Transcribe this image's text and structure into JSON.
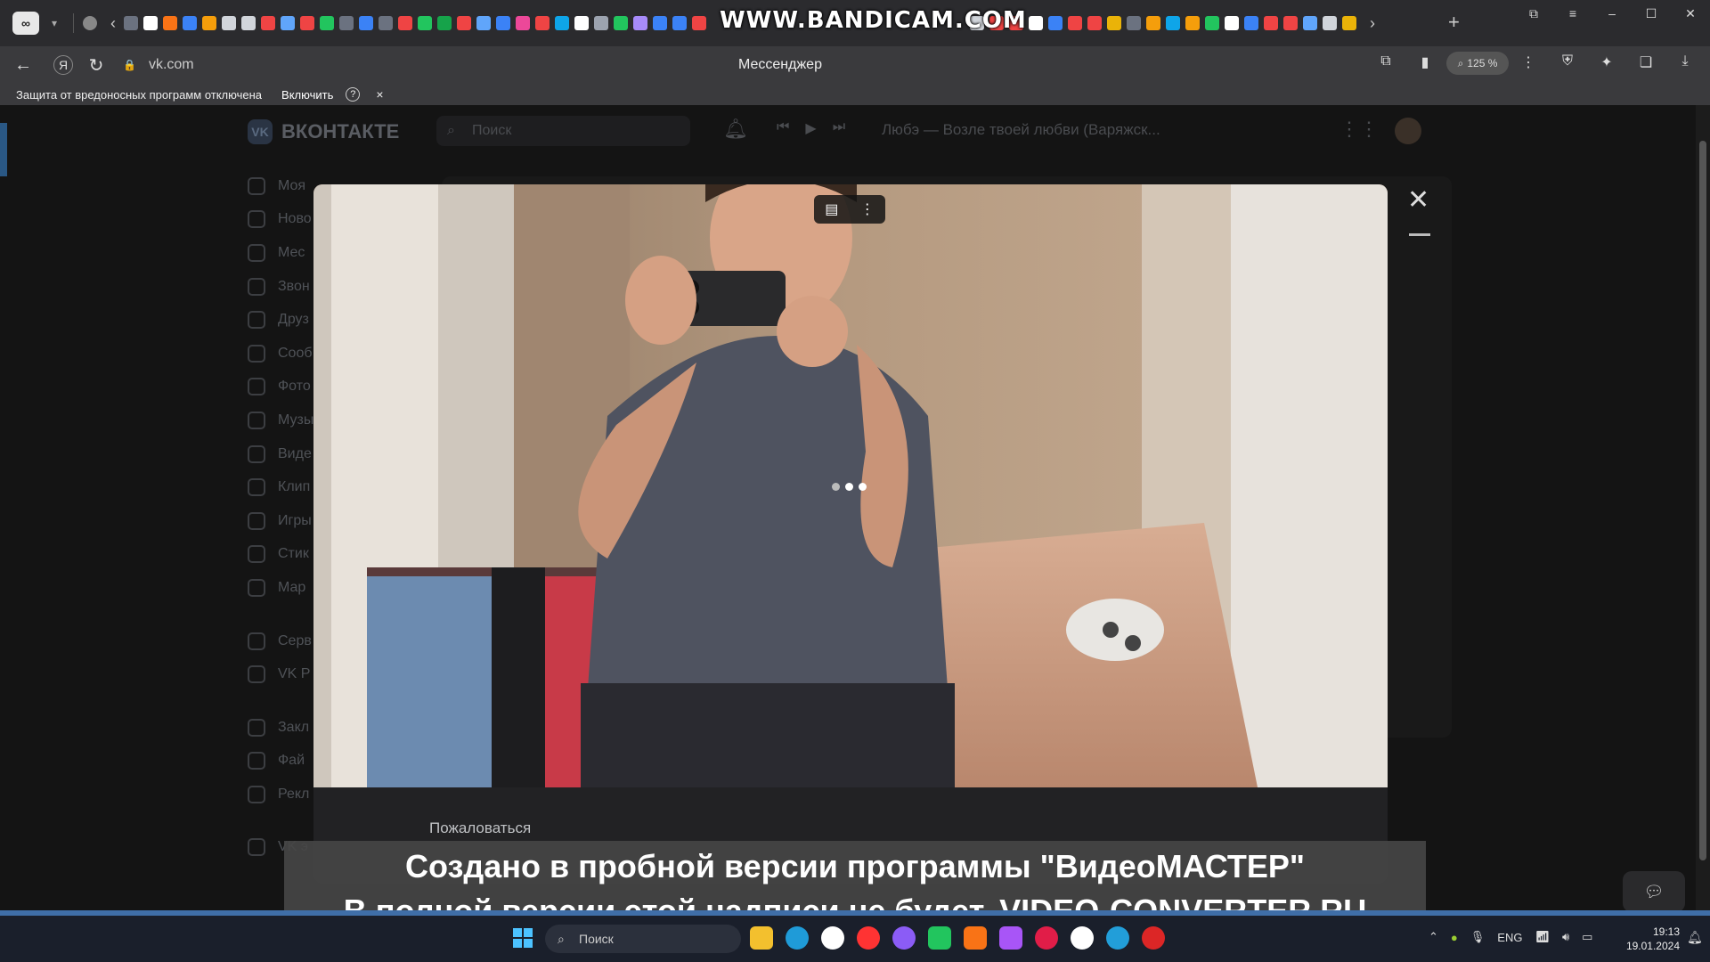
{
  "browser": {
    "watermark": "WWW.BANDICAM.COM",
    "page_title": "Мессенджер",
    "url": "vk.com",
    "zoom": "125 %",
    "infobar": {
      "message": "Защита от вредоносных программ отключена",
      "enable_label": "Включить",
      "help": "?",
      "close": "×"
    },
    "controls": {
      "back": "←",
      "reload": "↻",
      "yandex": "Я",
      "minimize": "–",
      "maximize": "☐",
      "close": "✕",
      "new_tab": "+"
    }
  },
  "vk": {
    "logo_text": "ВКОНТАКТЕ",
    "logo_mark": "VK",
    "search_placeholder": "Поиск",
    "track": "Любэ — Возле твоей любви (Варяжск...",
    "sidebar": [
      {
        "label": "Моя"
      },
      {
        "label": "Ново"
      },
      {
        "label": "Мес"
      },
      {
        "label": "Звон"
      },
      {
        "label": "Друз"
      },
      {
        "label": "Сооб"
      },
      {
        "label": "Фото"
      },
      {
        "label": "Музы"
      },
      {
        "label": "Виде"
      },
      {
        "label": "Клип"
      },
      {
        "label": "Игры"
      },
      {
        "label": "Стик"
      },
      {
        "label": "Мар"
      }
    ],
    "sidebar_2": [
      {
        "label": "Серв"
      },
      {
        "label": "VK P"
      }
    ],
    "sidebar_3": [
      {
        "label": "Закл"
      },
      {
        "label": "Фай"
      },
      {
        "label": "Рекл"
      }
    ],
    "sidebar_4": [
      {
        "label": "VK э"
      }
    ]
  },
  "viewer": {
    "report_label": "Пожаловаться",
    "close": "✕"
  },
  "watermark_bottom": {
    "line1": "Создано в пробной версии программы \"ВидеоМАСТЕР\"",
    "line2": "В полной версии этой надписи не будет. VIDEO-CONVERTER.RU"
  },
  "taskbar": {
    "search_placeholder": "Поиск",
    "lang": "ENG",
    "time": "19:13",
    "date": "19.01.2024"
  },
  "colors": {
    "accent": "#2a5885",
    "taskbar": "#1a1f2b",
    "chrome": "#2b2b2e"
  }
}
